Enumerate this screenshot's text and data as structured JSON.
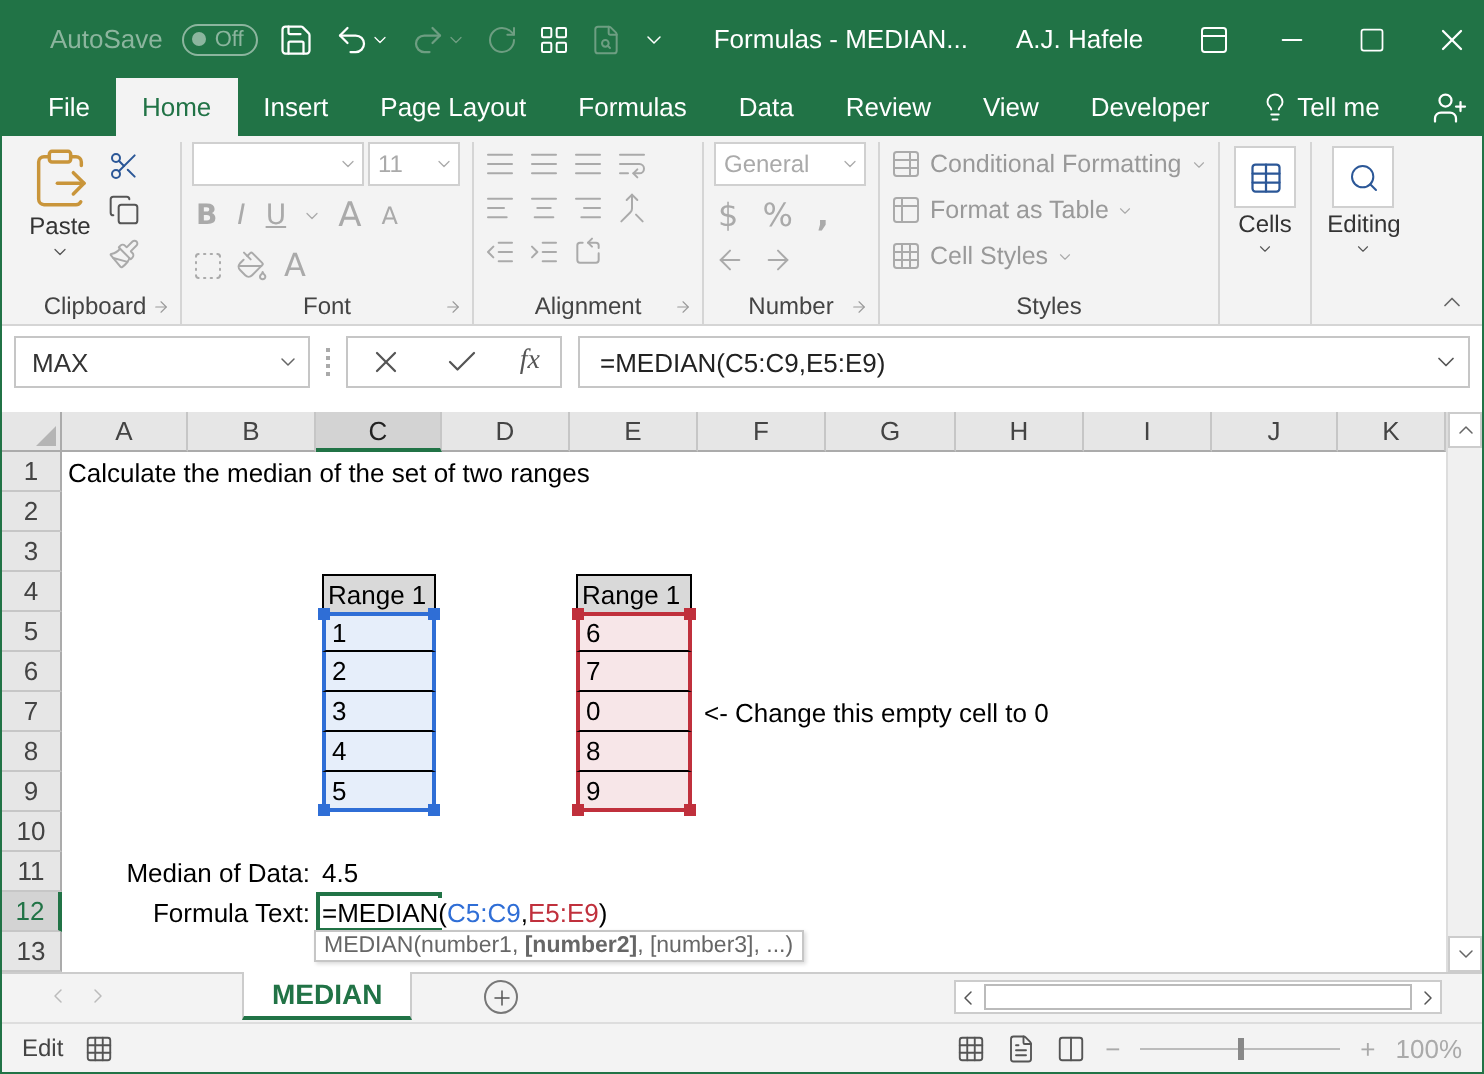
{
  "title_bar": {
    "autosave": {
      "label": "AutoSave",
      "state": "Off",
      "on": false
    },
    "document_title": "Formulas - MEDIAN...",
    "user": "A.J. Hafele"
  },
  "menu_tabs": [
    {
      "label": "File",
      "selected": false
    },
    {
      "label": "Home",
      "selected": true
    },
    {
      "label": "Insert",
      "selected": false
    },
    {
      "label": "Page Layout",
      "selected": false
    },
    {
      "label": "Formulas",
      "selected": false
    },
    {
      "label": "Data",
      "selected": false
    },
    {
      "label": "Review",
      "selected": false
    },
    {
      "label": "View",
      "selected": false
    },
    {
      "label": "Developer",
      "selected": false
    }
  ],
  "tell_me": "Tell me",
  "ribbon": {
    "clipboard": {
      "paste": "Paste",
      "label": "Clipboard"
    },
    "font": {
      "size": "11",
      "bold": "B",
      "italic": "I",
      "underline": "U",
      "grow": "A",
      "shrink": "A",
      "font_color_glyph": "A",
      "label": "Font"
    },
    "alignment": {
      "label": "Alignment"
    },
    "number": {
      "format": "General",
      "currency": "$",
      "percent": "%",
      "comma": ",",
      "label": "Number"
    },
    "styles": {
      "items": [
        "Conditional Formatting",
        "Format as Table",
        "Cell Styles"
      ],
      "label": "Styles"
    },
    "cells": "Cells",
    "editing": "Editing"
  },
  "formula_bar": {
    "name_box": "MAX",
    "function_label": "fx",
    "formula": "=MEDIAN(C5:C9,E5:E9)"
  },
  "sheet": {
    "columns": [
      {
        "label": "A",
        "selected": false
      },
      {
        "label": "B",
        "selected": false
      },
      {
        "label": "C",
        "selected": true
      },
      {
        "label": "D",
        "selected": false
      },
      {
        "label": "E",
        "selected": false
      },
      {
        "label": "F",
        "selected": false
      },
      {
        "label": "G",
        "selected": false
      },
      {
        "label": "H",
        "selected": false
      },
      {
        "label": "I",
        "selected": false
      },
      {
        "label": "J",
        "selected": false
      },
      {
        "label": "K",
        "selected": false
      }
    ],
    "rows": [
      {
        "header": "1",
        "selected": false,
        "cells": [
          {
            "kind": "text",
            "text": "Calculate the median of the set of two ranges"
          }
        ]
      },
      {
        "header": "2",
        "selected": false,
        "cells": []
      },
      {
        "header": "3",
        "selected": false,
        "cells": []
      },
      {
        "header": "4",
        "selected": false,
        "cells": [
          {
            "kind": "empty"
          },
          {
            "kind": "empty"
          },
          {
            "kind": "range-header",
            "text": "Range 1"
          },
          {
            "kind": "empty"
          },
          {
            "kind": "range-header",
            "text": "Range 1"
          }
        ]
      },
      {
        "header": "5",
        "selected": false,
        "cells": [
          {
            "kind": "empty"
          },
          {
            "kind": "empty"
          },
          {
            "kind": "range-first",
            "color": "#2f6ed6",
            "text": "1"
          },
          {
            "kind": "empty"
          },
          {
            "kind": "range-first",
            "color": "#c0303c",
            "text": "6"
          }
        ]
      },
      {
        "header": "6",
        "selected": false,
        "cells": [
          {
            "kind": "empty"
          },
          {
            "kind": "empty"
          },
          {
            "kind": "range",
            "color": "#2f6ed6",
            "text": "2"
          },
          {
            "kind": "empty"
          },
          {
            "kind": "range",
            "color": "#c0303c",
            "text": "7"
          }
        ]
      },
      {
        "header": "7",
        "selected": false,
        "cells": [
          {
            "kind": "empty"
          },
          {
            "kind": "empty"
          },
          {
            "kind": "range",
            "color": "#2f6ed6",
            "text": "3"
          },
          {
            "kind": "empty"
          },
          {
            "kind": "range",
            "color": "#c0303c",
            "text": "0"
          },
          {
            "kind": "text",
            "text": "<- Change this empty cell to 0"
          }
        ]
      },
      {
        "header": "8",
        "selected": false,
        "cells": [
          {
            "kind": "empty"
          },
          {
            "kind": "empty"
          },
          {
            "kind": "range",
            "color": "#2f6ed6",
            "text": "4"
          },
          {
            "kind": "empty"
          },
          {
            "kind": "range",
            "color": "#c0303c",
            "text": "8"
          }
        ]
      },
      {
        "header": "9",
        "selected": false,
        "cells": [
          {
            "kind": "empty"
          },
          {
            "kind": "empty"
          },
          {
            "kind": "range-last",
            "color": "#2f6ed6",
            "text": "5"
          },
          {
            "kind": "empty"
          },
          {
            "kind": "range-last",
            "color": "#c0303c",
            "text": "9"
          }
        ]
      },
      {
        "header": "10",
        "selected": false,
        "cells": []
      },
      {
        "header": "11",
        "selected": false,
        "cells": [
          {
            "kind": "empty"
          },
          {
            "kind": "label",
            "text": "Median of Data:"
          },
          {
            "kind": "text",
            "text": "4.5"
          }
        ]
      },
      {
        "header": "12",
        "selected": true,
        "cells": [
          {
            "kind": "empty"
          },
          {
            "kind": "label",
            "text": "Formula Text:"
          },
          {
            "kind": "active",
            "segments": [
              {
                "text": "=MEDIAN(",
                "color": "#000000"
              },
              {
                "text": "C5:C9",
                "color": "#2f6ed6"
              },
              {
                "text": ",",
                "color": "#000000"
              },
              {
                "text": "E5:E9",
                "color": "#c0303c"
              },
              {
                "text": ")",
                "color": "#000000"
              }
            ]
          }
        ]
      },
      {
        "header": "13",
        "selected": false,
        "cells": []
      }
    ],
    "tooltip": "MEDIAN(number1, **[number2]**, [number3], ...)"
  },
  "sheet_tabs": [
    {
      "label": "MEDIAN",
      "selected": true
    }
  ],
  "status_bar": {
    "mode": "Edit",
    "zoom_out": "−",
    "zoom_in": "+",
    "zoom_slider": {
      "level": 0.5
    },
    "zoom": "100%"
  }
}
